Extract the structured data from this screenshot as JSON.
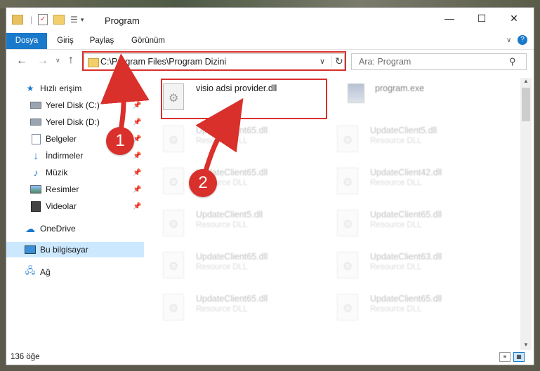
{
  "window": {
    "title": "Program",
    "controls": {
      "minimize": "—",
      "maximize": "☐",
      "close": "✕"
    }
  },
  "ribbon": {
    "tabs": [
      {
        "label": "Dosya",
        "active": true
      },
      {
        "label": "Giriş",
        "active": false
      },
      {
        "label": "Paylaş",
        "active": false
      },
      {
        "label": "Görünüm",
        "active": false
      }
    ],
    "help_icon": "?"
  },
  "nav": {
    "address": "C:\\Program Files\\Program Dizini",
    "search_placeholder": "Ara: Program"
  },
  "sidebar": {
    "items": [
      {
        "label": "Hızlı erişim",
        "icon": "star-icon",
        "pinned": false
      },
      {
        "label": "Yerel Disk (C:)",
        "icon": "drive-icon",
        "pinned": true
      },
      {
        "label": "Yerel Disk (D:)",
        "icon": "drive-icon",
        "pinned": true
      },
      {
        "label": "Belgeler",
        "icon": "documents-icon",
        "pinned": true
      },
      {
        "label": "İndirmeler",
        "icon": "downloads-icon",
        "pinned": true
      },
      {
        "label": "Müzik",
        "icon": "music-icon",
        "pinned": true
      },
      {
        "label": "Resimler",
        "icon": "pictures-icon",
        "pinned": true
      },
      {
        "label": "Videolar",
        "icon": "videos-icon",
        "pinned": true
      },
      {
        "label": "OneDrive",
        "icon": "cloud-icon",
        "pinned": false
      },
      {
        "label": "Bu bilgisayar",
        "icon": "computer-icon",
        "pinned": false,
        "selected": true
      },
      {
        "label": "Ağ",
        "icon": "network-icon",
        "pinned": false
      }
    ]
  },
  "files": {
    "highlighted": {
      "name": "visio adsi provider.dll"
    },
    "program_exe": {
      "name": "program.exe"
    },
    "items": [
      {
        "name": "UpdateClient65.dll",
        "type": "Resource DLL"
      },
      {
        "name": "UpdateClient5.dll",
        "type": "Resource DLL"
      },
      {
        "name": "UpdateClient65.dll",
        "type": "Resource DLL"
      },
      {
        "name": "UpdateClient42.dll",
        "type": "Resource DLL"
      },
      {
        "name": "UpdateClient5.dll",
        "type": "Resource DLL"
      },
      {
        "name": "UpdateClient65.dll",
        "type": "Resource DLL"
      },
      {
        "name": "UpdateClient65.dll",
        "type": "Resource DLL"
      },
      {
        "name": "UpdateClient63.dll",
        "type": "Resource DLL"
      },
      {
        "name": "UpdateClient65.dll",
        "type": "Resource DLL"
      },
      {
        "name": "UpdateClient65.dll",
        "type": "Resource DLL"
      }
    ]
  },
  "status": {
    "count": "136 öğe"
  },
  "annotations": {
    "step1": "1",
    "step2": "2"
  },
  "colors": {
    "accent": "#1979ca",
    "highlight": "#d9302c",
    "selection": "#cce8ff"
  }
}
